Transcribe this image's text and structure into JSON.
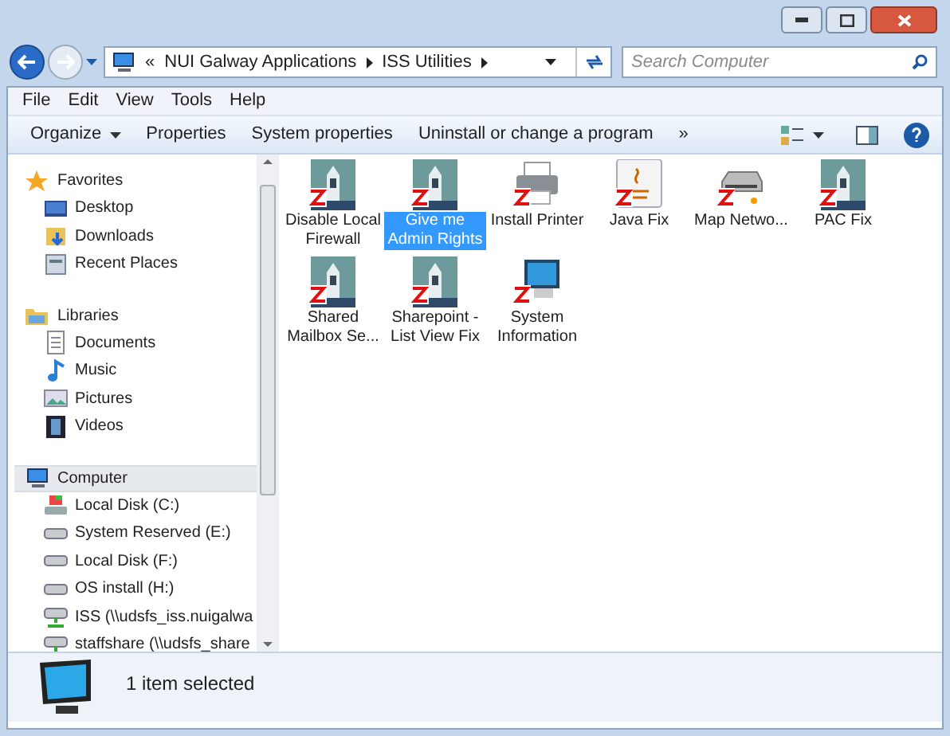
{
  "address": {
    "prefix": "«",
    "segments": [
      "NUI Galway Applications",
      "ISS Utilities"
    ]
  },
  "search": {
    "placeholder": "Search Computer"
  },
  "menu": [
    "File",
    "Edit",
    "View",
    "Tools",
    "Help"
  ],
  "commands": [
    {
      "label": "Organize",
      "dropdown": true
    },
    {
      "label": "Properties",
      "dropdown": false
    },
    {
      "label": "System properties",
      "dropdown": false
    },
    {
      "label": "Uninstall or change a program",
      "dropdown": false
    },
    {
      "label": "»",
      "dropdown": false
    }
  ],
  "sidebar": [
    {
      "label": "Favorites",
      "kind": "star",
      "selected": false,
      "children": [
        {
          "label": "Desktop",
          "kind": "desktop"
        },
        {
          "label": "Downloads",
          "kind": "folder"
        },
        {
          "label": "Recent Places",
          "kind": "recent"
        }
      ]
    },
    {
      "label": "Libraries",
      "kind": "library",
      "selected": false,
      "children": [
        {
          "label": "Documents",
          "kind": "document"
        },
        {
          "label": "Music",
          "kind": "music"
        },
        {
          "label": "Pictures",
          "kind": "pictures"
        },
        {
          "label": "Videos",
          "kind": "video"
        }
      ]
    },
    {
      "label": "Computer",
      "kind": "computer",
      "selected": true,
      "children": [
        {
          "label": "Local Disk (C:)",
          "kind": "sysdisk"
        },
        {
          "label": "System Reserved (E:)",
          "kind": "disk"
        },
        {
          "label": "Local Disk (F:)",
          "kind": "disk"
        },
        {
          "label": "OS install (H:)",
          "kind": "disk"
        },
        {
          "label": "ISS (\\\\udsfs_iss.nuigalwa",
          "kind": "netdrive"
        },
        {
          "label": "staffshare (\\\\udsfs_share",
          "kind": "netdrive"
        }
      ]
    }
  ],
  "files": [
    {
      "label": "Disable Local Firewall",
      "kind": "tower",
      "selected": false
    },
    {
      "label": "Give me Admin Rights",
      "kind": "tower",
      "selected": true
    },
    {
      "label": "Install Printer",
      "kind": "printer",
      "selected": false
    },
    {
      "label": "Java Fix",
      "kind": "java",
      "selected": false
    },
    {
      "label": "Map Netwo...",
      "kind": "drive",
      "selected": false
    },
    {
      "label": "PAC Fix",
      "kind": "tower",
      "selected": false
    },
    {
      "label": "Shared Mailbox Se...",
      "kind": "tower",
      "selected": false
    },
    {
      "label": "Sharepoint - List View Fix",
      "kind": "tower",
      "selected": false
    },
    {
      "label": "System Information",
      "kind": "computer",
      "selected": false
    }
  ],
  "status": "1 item selected"
}
